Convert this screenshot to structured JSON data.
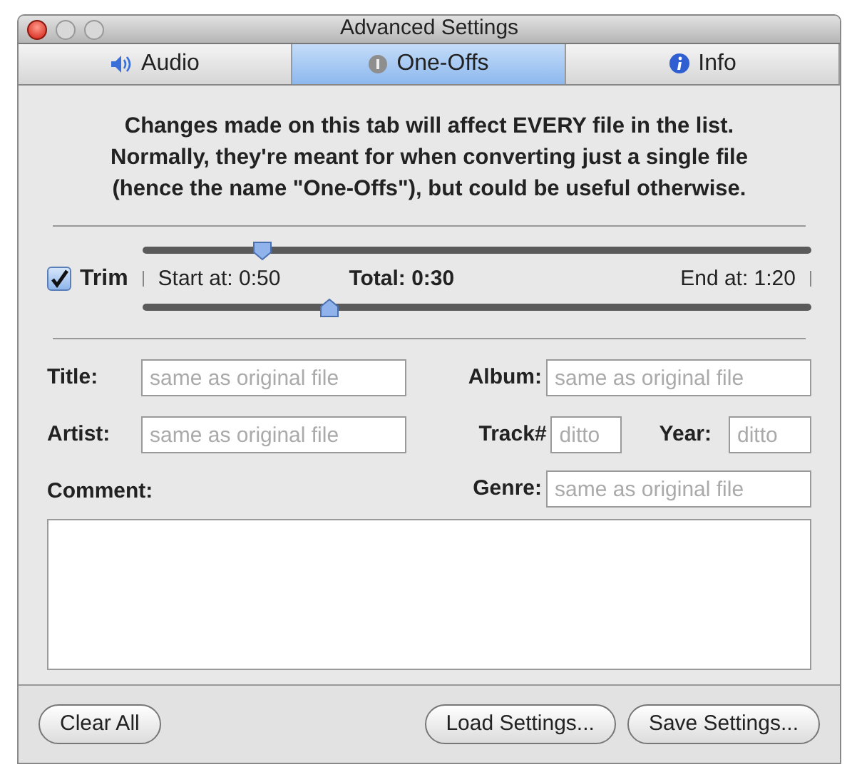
{
  "window": {
    "title": "Advanced Settings"
  },
  "tabs": [
    {
      "label": "Audio",
      "kind": "speaker",
      "selected": false
    },
    {
      "label": "One-Offs",
      "kind": "number",
      "selected": true
    },
    {
      "label": "Info",
      "kind": "info",
      "selected": false
    }
  ],
  "description": "Changes made on this tab will affect EVERY file in the list.\nNormally, they're meant for when converting just a single file\n(hence the name \"One-Offs\"), but could be useful otherwise.",
  "trim": {
    "label": "Trim",
    "checked": true,
    "start_slider": {
      "level": 0.18
    },
    "end_slider": {
      "level": 0.28
    },
    "start": "Start at: 0:50",
    "total": "Total: 0:30",
    "end": "End at: 1:20"
  },
  "fields": [
    {
      "label": "Title:",
      "placeholder": "same as original file"
    },
    {
      "label": "Album:",
      "placeholder": "same as original file"
    },
    {
      "label": "Artist:",
      "placeholder": "same as original file"
    },
    {
      "label": "Track#",
      "placeholder": "ditto"
    },
    {
      "label": "Year:",
      "placeholder": "ditto"
    },
    {
      "label": "Genre:",
      "placeholder": "same as original file"
    }
  ],
  "comment": {
    "label": "Comment:"
  },
  "buttons": [
    "Clear All",
    "Load Settings...",
    "Save Settings..."
  ]
}
